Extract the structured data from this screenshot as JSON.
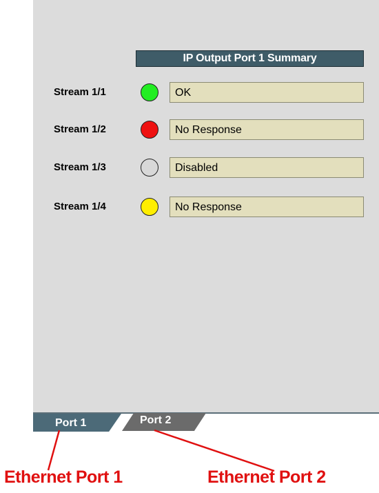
{
  "summary": {
    "title": "IP Output Port 1 Summary"
  },
  "streams": [
    {
      "label": "Stream 1/1",
      "status": "OK",
      "led_color": "#22ee22"
    },
    {
      "label": "Stream 1/2",
      "status": "No Response",
      "led_color": "#ee1111"
    },
    {
      "label": "Stream 1/3",
      "status": "Disabled",
      "led_color": "#d8d8d8"
    },
    {
      "label": "Stream 1/4",
      "status": "No Response",
      "led_color": "#ffee00"
    }
  ],
  "tabs": [
    {
      "label": "Port 1",
      "active": true
    },
    {
      "label": "Port 2",
      "active": false
    }
  ],
  "callouts": [
    {
      "label": "Ethernet Port 1"
    },
    {
      "label": "Ethernet Port 2"
    }
  ],
  "colors": {
    "panel_bg": "#dcdcdc",
    "header_bg": "#3f5c68",
    "field_bg": "#e3dfbd",
    "callout": "#e01010"
  }
}
